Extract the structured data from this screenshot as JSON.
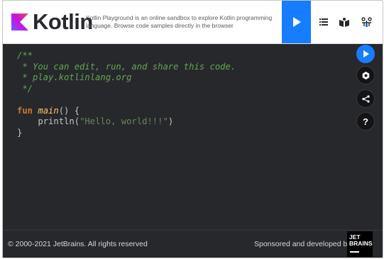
{
  "header": {
    "logo_text": "Kotlin",
    "tagline": "Kotlin Playground is an online sandbox to explore Kotlin programming language. Browse code samples directly in the browser",
    "buttons": [
      {
        "name": "run-button",
        "icon": "play-icon"
      },
      {
        "name": "examples-button",
        "icon": "list-icon"
      },
      {
        "name": "koans-button",
        "icon": "book-icon"
      },
      {
        "name": "settings-button",
        "icon": "nodes-icon"
      }
    ]
  },
  "code": {
    "comment_lines": [
      "/**",
      " * You can edit, run, and share this code.",
      " * play.kotlinlang.org",
      " */"
    ],
    "keyword": "fun",
    "function_name": "main",
    "signature_rest": "() {",
    "body_call": "    println(",
    "string_literal": "\"Hello, world!!!\"",
    "body_close_paren": ")",
    "close_brace": "}"
  },
  "sidebar": {
    "help_label": "?"
  },
  "footer": {
    "copyright": "© 2000-2021 JetBrains. All rights reserved",
    "sponsor": "Sponsored and developed by",
    "jetbrains_logo_text": "JET\nBRAINS"
  },
  "colors": {
    "accent": "#167dff",
    "editor_bg": "#27282c",
    "comment": "#61a851",
    "keyword": "#cc7832",
    "string": "#6a8759"
  }
}
